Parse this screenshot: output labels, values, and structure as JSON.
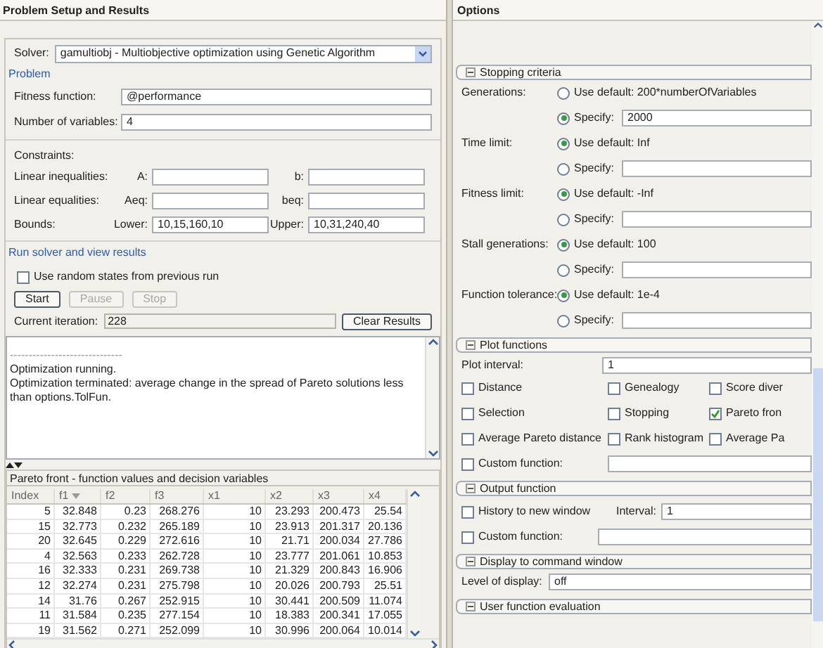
{
  "setup": {
    "title": "Problem Setup and Results",
    "solver": {
      "label": "Solver:",
      "value": "gamultiobj - Multiobjective optimization using Genetic Algorithm"
    },
    "problem": {
      "legend": "Problem",
      "fields": [
        {
          "label": "Fitness function:",
          "value": "@performance"
        },
        {
          "label": "Number of variables:",
          "value": "4"
        }
      ]
    },
    "constraints": {
      "heading": "Constraints:",
      "rows": [
        {
          "label": "Linear inequalities:",
          "fields": [
            {
              "label": "A:"
            },
            {
              "label": "b:"
            }
          ]
        },
        {
          "label": "Linear equalities:",
          "fields": [
            {
              "label": "Aeq:"
            },
            {
              "label": "beq:"
            }
          ]
        },
        {
          "label": "Bounds:",
          "fields": [
            {
              "label": "Lower:",
              "value": "10,15,160,10"
            },
            {
              "label": "Upper:",
              "value": "10,31,240,40"
            }
          ]
        }
      ]
    },
    "run": {
      "legend": "Run solver and view results",
      "random_states": {
        "label": "Use random states from previous run",
        "checked": false
      },
      "buttons": [
        {
          "label": "Start",
          "disabled": false
        },
        {
          "label": "Pause",
          "disabled": true
        },
        {
          "label": "Stop",
          "disabled": true
        }
      ],
      "iteration_label": "Current iteration:",
      "iteration": "228",
      "clear_button": "Clear Results",
      "log": [
        "------------------------------",
        "Optimization running.",
        "Optimization terminated: average change in the spread of Pareto solutions less than options.TolFun."
      ]
    },
    "results": {
      "title": "Pareto front - function values and decision variables",
      "columns": [
        {
          "label": "Index",
          "sorted": false
        },
        {
          "label": "f1",
          "sorted": true
        },
        {
          "label": "f2",
          "sorted": false
        },
        {
          "label": "f3",
          "sorted": false
        },
        {
          "label": "x1",
          "sorted": false
        },
        {
          "label": "x2",
          "sorted": false
        },
        {
          "label": "x3",
          "sorted": false
        },
        {
          "label": "x4",
          "sorted": false
        }
      ],
      "rows": [
        [
          "5",
          "32.848",
          "0.23",
          "268.276",
          "10",
          "23.293",
          "200.473",
          "25.54"
        ],
        [
          "15",
          "32.773",
          "0.232",
          "265.189",
          "10",
          "23.913",
          "201.317",
          "20.136"
        ],
        [
          "20",
          "32.645",
          "0.229",
          "272.616",
          "10",
          "21.71",
          "200.034",
          "27.786"
        ],
        [
          "4",
          "32.563",
          "0.233",
          "262.728",
          "10",
          "23.777",
          "201.061",
          "10.853"
        ],
        [
          "16",
          "32.333",
          "0.231",
          "269.738",
          "10",
          "21.329",
          "200.843",
          "16.906"
        ],
        [
          "12",
          "32.274",
          "0.231",
          "275.798",
          "10",
          "20.026",
          "200.793",
          "25.51"
        ],
        [
          "14",
          "31.76",
          "0.267",
          "252.915",
          "10",
          "30.441",
          "200.509",
          "11.074"
        ],
        [
          "11",
          "31.584",
          "0.235",
          "277.154",
          "10",
          "18.383",
          "200.341",
          "17.055"
        ],
        [
          "19",
          "31.562",
          "0.271",
          "252.099",
          "10",
          "30.996",
          "200.064",
          "10.014"
        ]
      ]
    }
  },
  "options": {
    "title": "Options",
    "sections": [
      {
        "kind": "criteria",
        "title": "Stopping criteria",
        "expanded": true,
        "items": [
          {
            "label": "Generations:",
            "default": "Use default: 200*numberOfVariables",
            "specify": "Specify:",
            "value": "2000",
            "use_default": false
          },
          {
            "label": "Time limit:",
            "default": "Use default: Inf",
            "specify": "Specify:",
            "use_default": true
          },
          {
            "label": "Fitness limit:",
            "default": "Use default: -Inf",
            "specify": "Specify:",
            "use_default": true
          },
          {
            "label": "Stall generations:",
            "default": "Use default: 100",
            "specify": "Specify:",
            "use_default": true
          },
          {
            "label": "Function tolerance:",
            "default": "Use default: 1e-4",
            "specify": "Specify:",
            "use_default": true
          }
        ]
      },
      {
        "kind": "plot",
        "title": "Plot functions",
        "expanded": true,
        "interval_label": "Plot interval:",
        "interval": "1",
        "checkboxes": [
          {
            "label": "Distance",
            "checked": false
          },
          {
            "label": "Genealogy",
            "checked": false
          },
          {
            "label": "Score diver",
            "checked": false
          },
          {
            "label": "Selection",
            "checked": false
          },
          {
            "label": "Stopping",
            "checked": false
          },
          {
            "label": "Pareto fron",
            "checked": true
          },
          {
            "label": "Average Pareto distance",
            "checked": false
          },
          {
            "label": "Rank histogram",
            "checked": false
          },
          {
            "label": "Average Pa",
            "checked": false
          }
        ],
        "custom": {
          "label": "Custom function:",
          "checked": false
        }
      },
      {
        "kind": "output",
        "title": "Output function",
        "expanded": true,
        "history": {
          "label": "History to new window",
          "checked": false
        },
        "interval_label": "Interval:",
        "interval": "1",
        "custom": {
          "label": "Custom function:",
          "checked": false
        }
      },
      {
        "kind": "display",
        "title": "Display to command window",
        "expanded": true,
        "label": "Level of display:",
        "value": "off"
      },
      {
        "kind": "header",
        "title": "User function evaluation",
        "expanded": true
      }
    ]
  }
}
